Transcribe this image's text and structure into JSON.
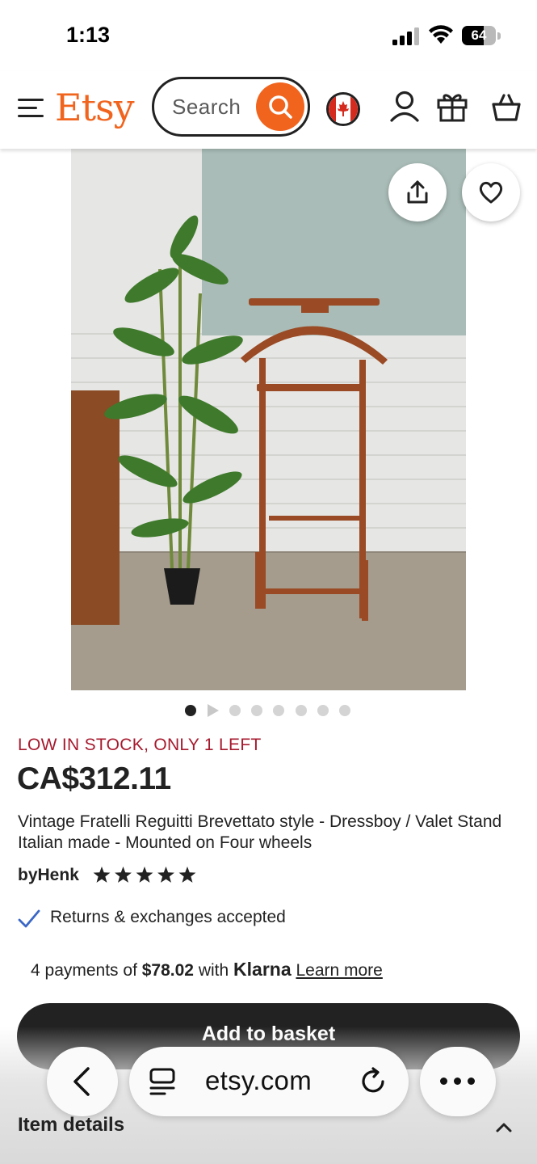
{
  "status_bar": {
    "time": "1:13",
    "battery_percent": "64",
    "battery_level": 0.64
  },
  "header": {
    "logo_text": "Etsy",
    "search_placeholder": "Search",
    "brand_color": "#f1641e",
    "icons": [
      "menu-icon",
      "search-icon",
      "canada-flag-icon",
      "user-icon",
      "gift-icon",
      "basket-icon"
    ]
  },
  "gallery": {
    "image_count": 8,
    "active_index": 0,
    "second_is_video": true,
    "actions": [
      "share-icon",
      "heart-icon"
    ]
  },
  "product": {
    "stock_note": "LOW IN STOCK, ONLY 1 LEFT",
    "price": "CA$312.11",
    "title": "Vintage Fratelli Reguitti Brevettato style - Dressboy / Valet Stand Italian made - Mounted on Four wheels",
    "shop_prefix": "by",
    "shop_name": "Henk",
    "rating_stars": 5,
    "returns": "Returns & exchanges accepted"
  },
  "klarna": {
    "prefix": "4 payments of",
    "amount": "$78.02",
    "middle": "with",
    "brand": "Klarna",
    "link": "Learn more"
  },
  "cta": {
    "add_to_basket": "Add to basket"
  },
  "browser": {
    "url": "etsy.com"
  },
  "section": {
    "item_details": "Item details"
  }
}
